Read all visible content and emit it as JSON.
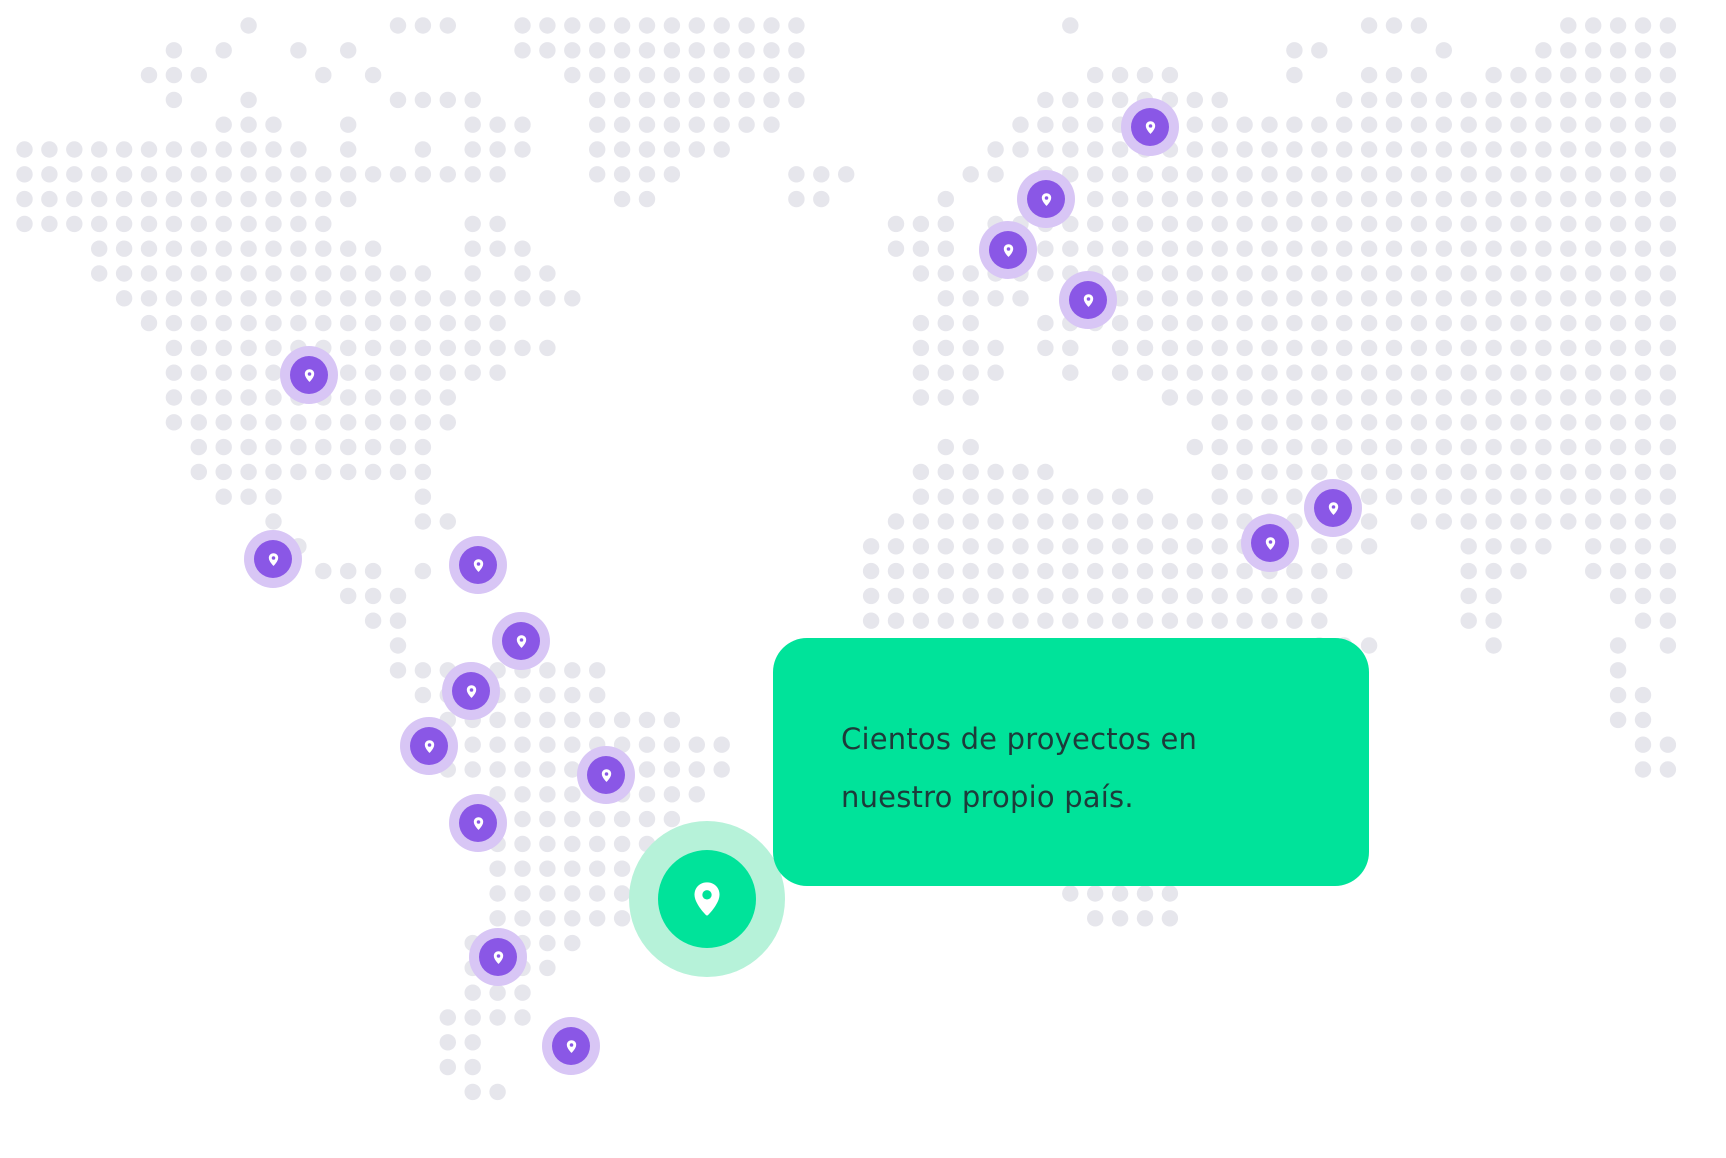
{
  "map": {
    "style": "dot-matrix world map",
    "dot_color": "#e6e6ec",
    "background_color": "#ffffff",
    "continents": [
      "north-america",
      "south-america",
      "europe",
      "africa",
      "asia"
    ]
  },
  "colors": {
    "office_pin_halo": "#d8c6f5",
    "office_pin_core": "#8a57e6",
    "home_pin_halo": "#b6f2d9",
    "home_pin_core": "#00e39a",
    "card_background": "#00e39a",
    "card_text": "#1d3b3a",
    "pin_glyph": "#ffffff"
  },
  "pins": {
    "icon": "location-pin-icon",
    "home_icon": "location-pin-icon"
  },
  "info_card": {
    "text": "Cientos de proyectos en nuestro propio país."
  }
}
